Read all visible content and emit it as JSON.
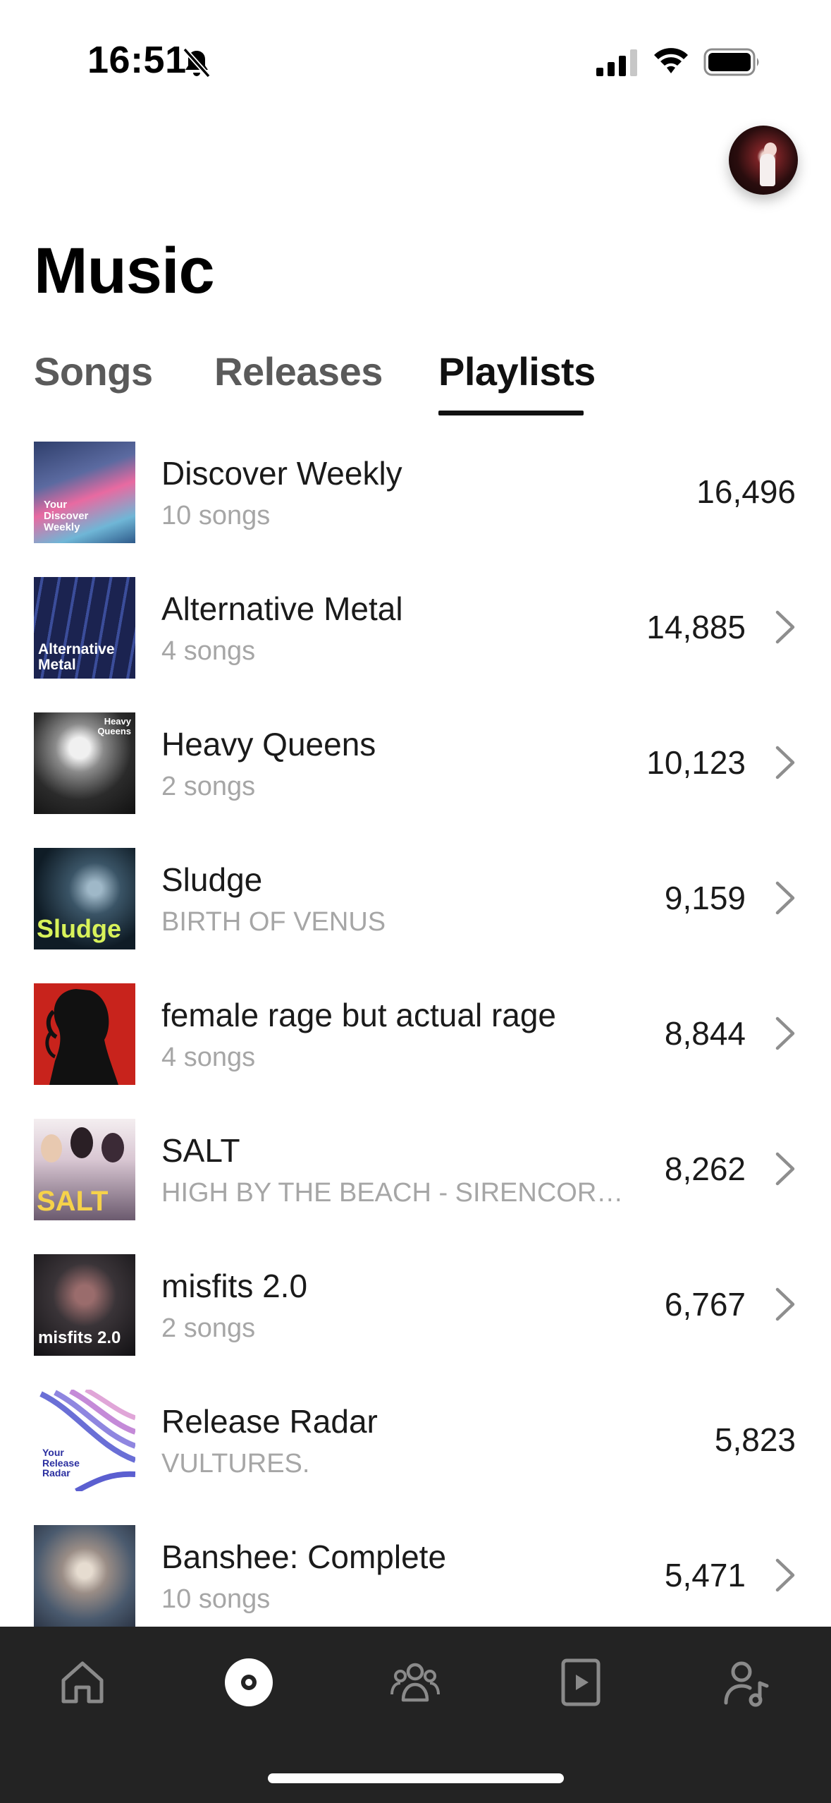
{
  "status_bar": {
    "time": "16:51"
  },
  "page": {
    "title": "Music"
  },
  "tabs": [
    {
      "label": "Songs",
      "active": false
    },
    {
      "label": "Releases",
      "active": false
    },
    {
      "label": "Playlists",
      "active": true
    }
  ],
  "playlists": [
    {
      "title": "Discover Weekly",
      "subtitle": "10 songs",
      "count": "16,496",
      "chevron": false,
      "cover_text": "Your Discover Weekly"
    },
    {
      "title": "Alternative Metal",
      "subtitle": "4 songs",
      "count": "14,885",
      "chevron": true,
      "cover_text": "Alternative Metal"
    },
    {
      "title": "Heavy Queens",
      "subtitle": "2 songs",
      "count": "10,123",
      "chevron": true,
      "cover_text": "Heavy Queens"
    },
    {
      "title": "Sludge",
      "subtitle": "BIRTH OF VENUS",
      "count": "9,159",
      "chevron": true,
      "cover_text": "Sludge"
    },
    {
      "title": "female rage but actual rage",
      "subtitle": "4 songs",
      "count": "8,844",
      "chevron": true,
      "cover_text": ""
    },
    {
      "title": "SALT",
      "subtitle": "HIGH BY THE BEACH - SIRENCORE...",
      "count": "8,262",
      "chevron": true,
      "cover_text": "SALT"
    },
    {
      "title": "misfits 2.0",
      "subtitle": "2 songs",
      "count": "6,767",
      "chevron": true,
      "cover_text": "misfits 2.0"
    },
    {
      "title": "Release Radar",
      "subtitle": "VULTURES.",
      "count": "5,823",
      "chevron": false,
      "cover_text": "Your Release Radar"
    },
    {
      "title": "Banshee: Complete",
      "subtitle": "10 songs",
      "count": "5,471",
      "chevron": true,
      "cover_text": ""
    }
  ],
  "tabbar": {
    "items": [
      {
        "icon": "home-icon",
        "active": false
      },
      {
        "icon": "record-icon",
        "active": true
      },
      {
        "icon": "people-icon",
        "active": false
      },
      {
        "icon": "play-square-icon",
        "active": false
      },
      {
        "icon": "artist-icon",
        "active": false
      }
    ]
  },
  "colors": {
    "tabbar_bg": "#232323",
    "subtitle": "#a6a6a6",
    "text": "#1a1a1a"
  }
}
